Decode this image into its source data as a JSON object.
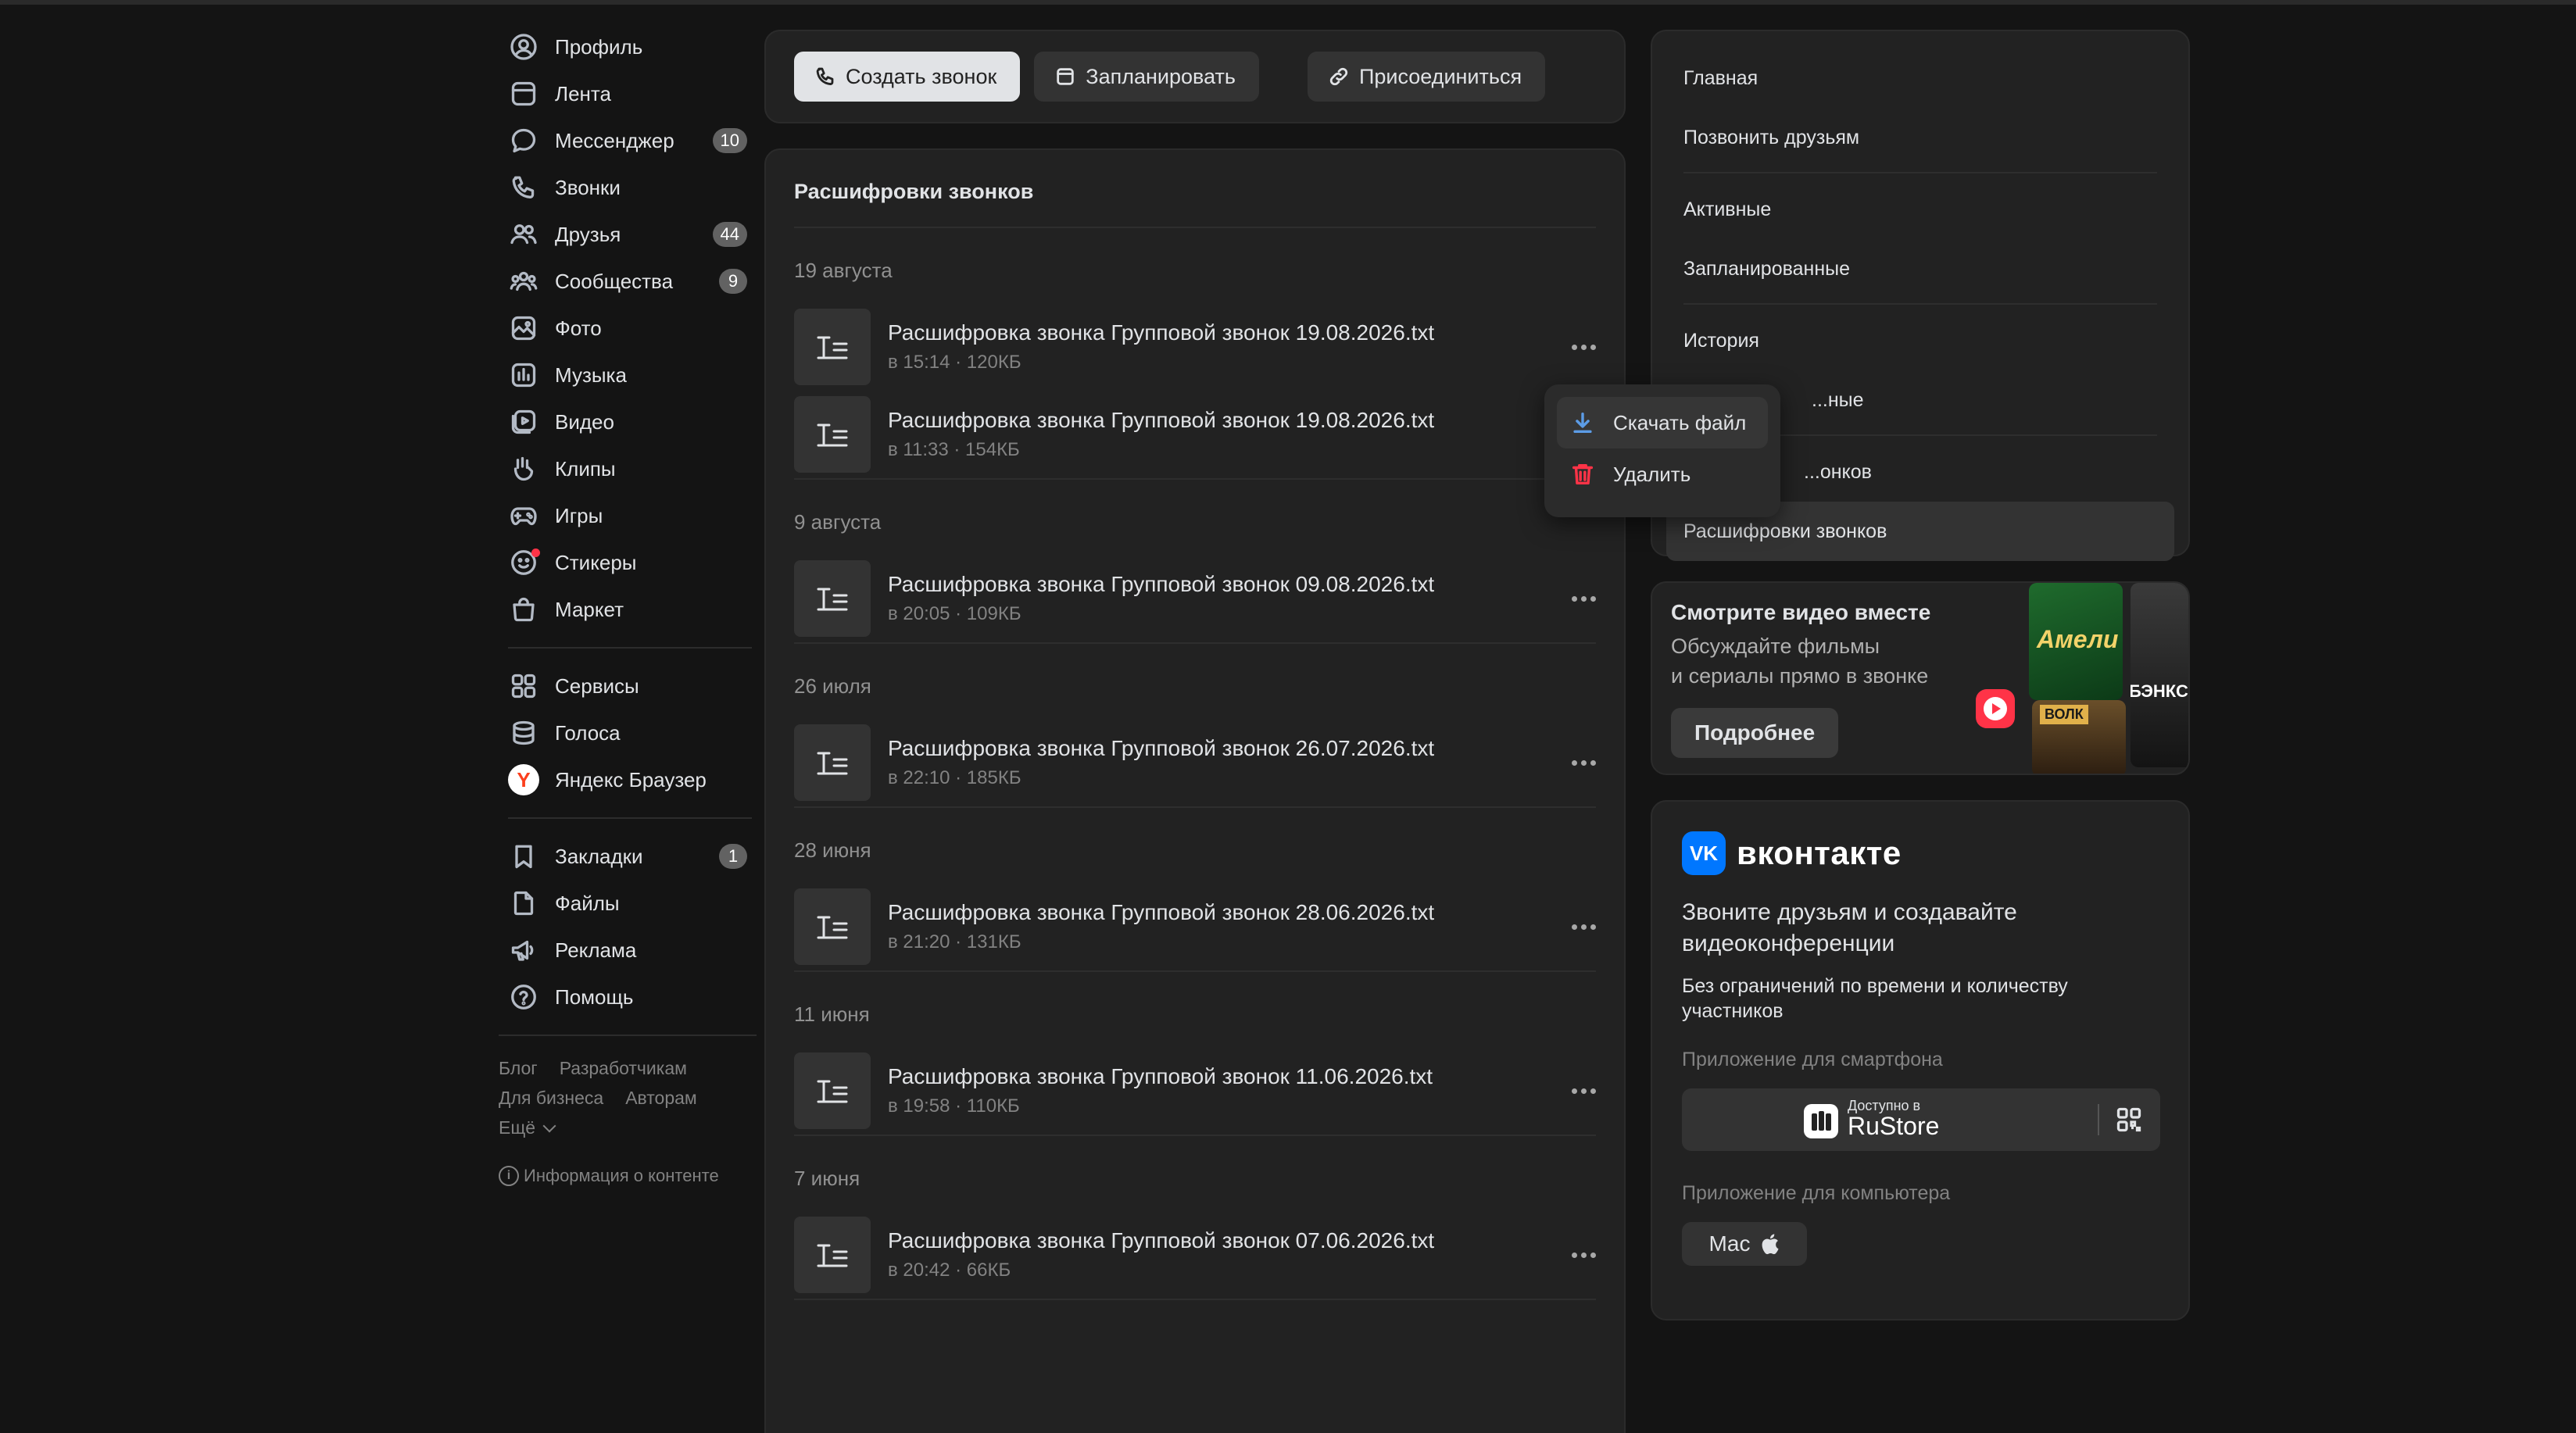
{
  "left_nav": {
    "items": [
      {
        "label": "Профиль",
        "icon": "profile-icon",
        "badge": ""
      },
      {
        "label": "Лента",
        "icon": "feed-icon",
        "badge": ""
      },
      {
        "label": "Мессенджер",
        "icon": "messenger-icon",
        "badge": "10"
      },
      {
        "label": "Звонки",
        "icon": "phone-icon",
        "badge": ""
      },
      {
        "label": "Друзья",
        "icon": "friends-icon",
        "badge": "44"
      },
      {
        "label": "Сообщества",
        "icon": "communities-icon",
        "badge": "9"
      },
      {
        "label": "Фото",
        "icon": "photo-icon",
        "badge": ""
      },
      {
        "label": "Музыка",
        "icon": "music-icon",
        "badge": ""
      },
      {
        "label": "Видео",
        "icon": "video-icon",
        "badge": ""
      },
      {
        "label": "Клипы",
        "icon": "clips-icon",
        "badge": ""
      },
      {
        "label": "Игры",
        "icon": "games-icon",
        "badge": ""
      },
      {
        "label": "Стикеры",
        "icon": "stickers-icon",
        "badge": ""
      },
      {
        "label": "Маркет",
        "icon": "market-icon",
        "badge": ""
      }
    ],
    "services": [
      {
        "label": "Сервисы",
        "icon": "services-icon"
      },
      {
        "label": "Голоса",
        "icon": "votes-icon"
      },
      {
        "label": "Яндекс Браузер",
        "icon": "yandex-browser-icon"
      }
    ],
    "extras": [
      {
        "label": "Закладки",
        "icon": "bookmark-icon",
        "badge": "1"
      },
      {
        "label": "Файлы",
        "icon": "files-icon",
        "badge": ""
      },
      {
        "label": "Реклама",
        "icon": "ads-icon",
        "badge": ""
      },
      {
        "label": "Помощь",
        "icon": "help-icon",
        "badge": ""
      }
    ],
    "footer": {
      "blog": "Блог",
      "developers": "Разработчикам",
      "business": "Для бизнеса",
      "authors": "Авторам",
      "more": "Ещё",
      "content_info": "Информация о контенте"
    }
  },
  "actions": {
    "create_call": "Создать звонок",
    "schedule": "Запланировать",
    "join": "Присоединиться"
  },
  "transcripts": {
    "title": "Расшифровки звонков",
    "groups": [
      {
        "date": "19 августа",
        "files": [
          {
            "name": "Расшифровка звонка Групповой звонок 19.08.2026.txt",
            "meta": "в 15:14 · 120КБ"
          },
          {
            "name": "Расшифровка звонка Групповой звонок 19.08.2026.txt",
            "meta": "в 11:33 · 154КБ"
          }
        ]
      },
      {
        "date": "9 августа",
        "files": [
          {
            "name": "Расшифровка звонка Групповой звонок 09.08.2026.txt",
            "meta": "в 20:05 · 109КБ"
          }
        ]
      },
      {
        "date": "26 июля",
        "files": [
          {
            "name": "Расшифровка звонка Групповой звонок 26.07.2026.txt",
            "meta": "в 22:10 · 185КБ"
          }
        ]
      },
      {
        "date": "28 июня",
        "files": [
          {
            "name": "Расшифровка звонка Групповой звонок 28.06.2026.txt",
            "meta": "в 21:20 · 131КБ"
          }
        ]
      },
      {
        "date": "11 июня",
        "files": [
          {
            "name": "Расшифровка звонка Групповой звонок 11.06.2026.txt",
            "meta": "в 19:58 · 110КБ"
          }
        ]
      },
      {
        "date": "7 июня",
        "files": [
          {
            "name": "Расшифровка звонка Групповой звонок 07.06.2026.txt",
            "meta": "в 20:42 · 66КБ"
          }
        ]
      }
    ]
  },
  "context_menu": {
    "download": "Скачать файл",
    "delete": "Удалить"
  },
  "right_nav": {
    "main": "Главная",
    "call_friends": "Позвонить друзьям",
    "active": "Активные",
    "scheduled": "Запланированные",
    "history": "История",
    "saved_partial": "...ные",
    "records_partial": "...онков",
    "transcripts": "Расшифровки звонков"
  },
  "promo": {
    "title": "Смотрите видео вместе",
    "desc_line1": "Обсуждайте фильмы",
    "desc_line2": "и сериалы прямо в звонке",
    "button": "Подробнее",
    "poster_amelie": "Амели",
    "poster_banksy": "БЭНКСИ",
    "poster_wolf": "ВОЛК"
  },
  "vk_panel": {
    "logo": "VK",
    "brand": "вконтакте",
    "headline": "Звоните друзьям и создавайте видеоконференции",
    "subline": "Без ограничений по времени и количеству участников",
    "phone_label": "Приложение для смартфона",
    "rustore_small": "Доступно в",
    "rustore_big": "RuStore",
    "desktop_label": "Приложение для компьютера",
    "mac": "Mac"
  },
  "colors": {
    "background": "#141414",
    "panel": "#222222",
    "accent": "#0077ff",
    "danger": "#ff3347",
    "download": "#5c9ce6"
  }
}
